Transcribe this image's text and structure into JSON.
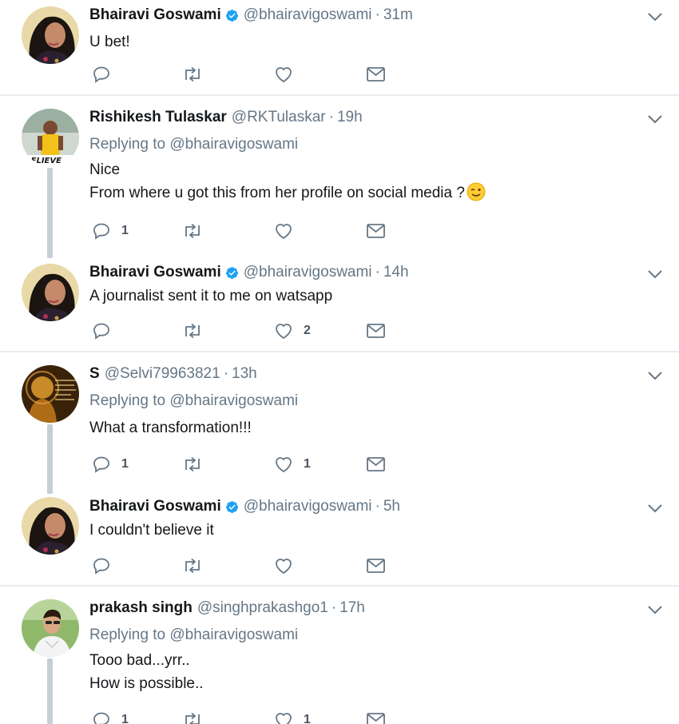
{
  "tweets": [
    {
      "name": "Bhairavi Goswami",
      "verified": true,
      "handle": "@bhairavigoswami",
      "separator": "·",
      "time": "31m",
      "replying_label": "",
      "replying_to": "",
      "text_lines": [
        "U bet!"
      ],
      "reply_count": "",
      "like_count": ""
    },
    {
      "name": "Rishikesh Tulaskar",
      "verified": false,
      "handle": "@RKTulaskar",
      "separator": "·",
      "time": "19h",
      "replying_label": "Replying to",
      "replying_to": "@bhairavigoswami",
      "text_lines": [
        "Nice",
        "From where u got this from her profile on social media ?"
      ],
      "reply_count": "1",
      "like_count": ""
    },
    {
      "name": "Bhairavi Goswami",
      "verified": true,
      "handle": "@bhairavigoswami",
      "separator": "·",
      "time": "14h",
      "replying_label": "",
      "replying_to": "",
      "text_lines": [
        "A journalist sent it to me on watsapp"
      ],
      "reply_count": "",
      "like_count": "2"
    },
    {
      "name": "S",
      "verified": false,
      "handle": "@Selvi79963821",
      "separator": "·",
      "time": "13h",
      "replying_label": "Replying to",
      "replying_to": "@bhairavigoswami",
      "text_lines": [
        "What a transformation!!!"
      ],
      "reply_count": "1",
      "like_count": "1"
    },
    {
      "name": "Bhairavi Goswami",
      "verified": true,
      "handle": "@bhairavigoswami",
      "separator": "·",
      "time": "5h",
      "replying_label": "",
      "replying_to": "",
      "text_lines": [
        "I couldn't believe it"
      ],
      "reply_count": "",
      "like_count": ""
    },
    {
      "name": "prakash singh",
      "verified": false,
      "handle": "@singhprakashgo1",
      "separator": "·",
      "time": "17h",
      "replying_label": "Replying to",
      "replying_to": "@bhairavigoswami",
      "text_lines": [
        "Tooo bad...yrr..",
        "How is possible.."
      ],
      "reply_count": "1",
      "like_count": "1"
    }
  ],
  "icons": {
    "reply": "reply-icon",
    "retweet": "retweet-icon",
    "like": "heart-icon",
    "dm": "envelope-icon",
    "caret": "chevron-down-icon",
    "verified": "verified-badge-icon",
    "emoji": "winking-face-emoji"
  },
  "colors": {
    "name": "#14171a",
    "secondary": "#657786",
    "verified_blue": "#1da1f2",
    "thread_line": "#c4cfd6",
    "divider": "#e6ecf0"
  }
}
